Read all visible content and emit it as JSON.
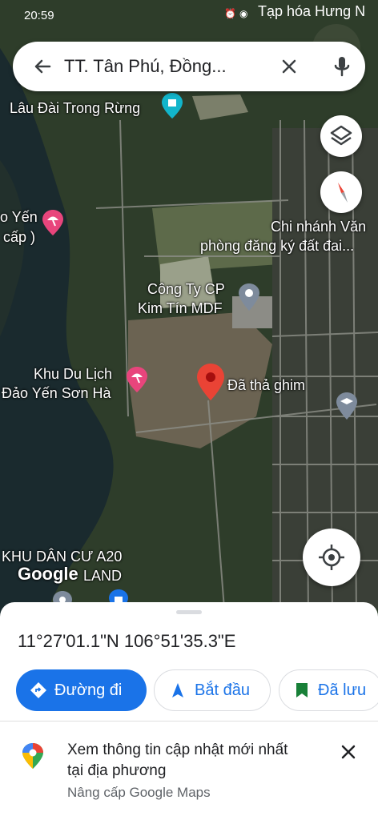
{
  "status_bar": {
    "time": "20:59",
    "notification_text": "Tạp hóa Hưng N"
  },
  "search": {
    "query": "TT. Tân Phú, Đồng..."
  },
  "map": {
    "labels": {
      "lau_dai": "Lâu Đài Trong Rừng",
      "yen_1": "o Yến",
      "yen_2": "cấp )",
      "chi_nhanh_1": "Chi nhánh Văn",
      "chi_nhanh_2": "phòng đăng ký đất đai...",
      "cong_ty_1": "Công Ty CP",
      "cong_ty_2": "Kim Tín MDF",
      "khu_du_lich_1": "Khu Du Lịch",
      "khu_du_lich_2": "Đảo Yến Sơn Hà",
      "dropped_pin": "Đã thả ghim",
      "khu_dan_cu_1": "KHU DÂN CƯ A20",
      "khu_dan_cu_2": "LAND",
      "google": "Google"
    }
  },
  "sheet": {
    "coordinates": "11°27'01.1\"N 106°51'35.3\"E",
    "actions": {
      "directions": "Đường đi",
      "start": "Bắt đầu",
      "saved": "Đã lưu"
    },
    "notice": {
      "title": "Xem thông tin cập nhật mới nhất tại địa phương",
      "subtitle": "Nâng cấp Google Maps"
    }
  },
  "colors": {
    "accent": "#1a73e8",
    "pin": "#ea4335",
    "poi_pink": "#e8457c",
    "poi_teal": "#12b5cb",
    "poi_gray": "#7e8b9c"
  }
}
